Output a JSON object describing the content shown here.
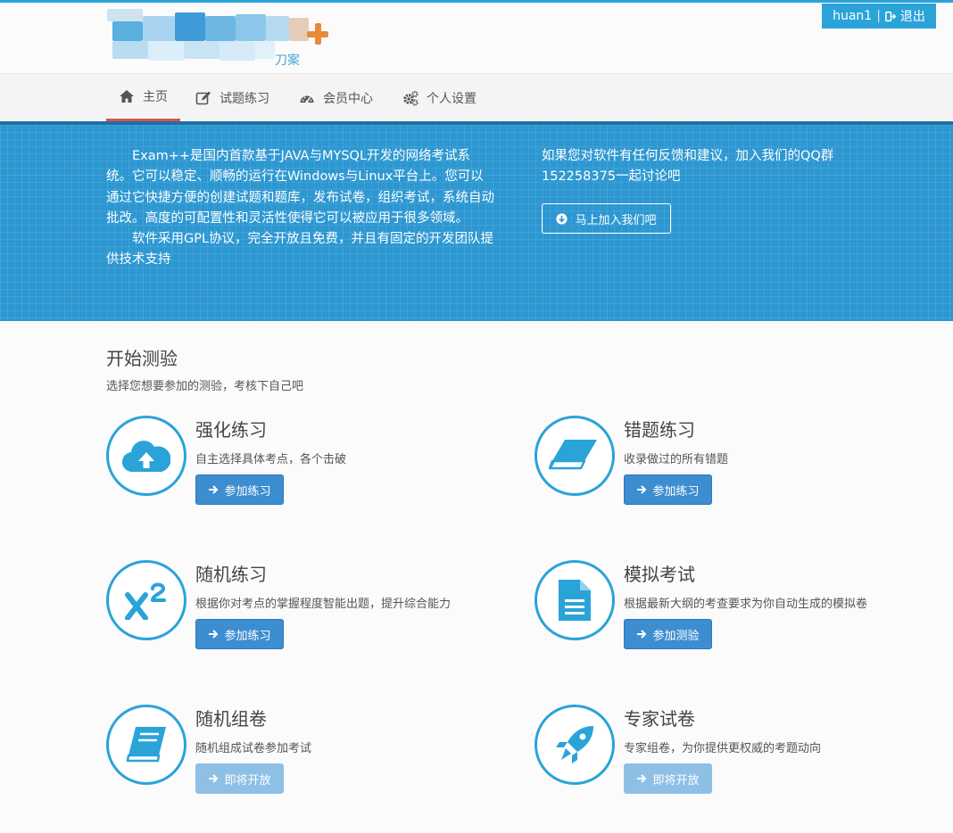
{
  "header": {
    "username": "huan1",
    "separator": "|",
    "logout_label": "退出",
    "logo_fragment": "刀案"
  },
  "nav": {
    "items": [
      {
        "label": "主页",
        "icon": "home-icon"
      },
      {
        "label": "试题练习",
        "icon": "edit-icon"
      },
      {
        "label": "会员中心",
        "icon": "dashboard-icon"
      },
      {
        "label": "个人设置",
        "icon": "cogs-icon"
      }
    ]
  },
  "banner": {
    "intro_p1": "Exam++是国内首款基于JAVA与MYSQL开发的网络考试系统。它可以稳定、顺畅的运行在Windows与Linux平台上。您可以通过它快捷方便的创建试题和题库，发布试卷，组织考试，系统自动批改。高度的可配置性和灵活性使得它可以被应用于很多领域。",
    "intro_p2": "软件采用GPL协议，完全开放且免费，并且有固定的开发团队提供技术支持",
    "feedback": "如果您对软件有任何反馈和建议，加入我们的QQ群152258375一起讨论吧",
    "join_button": "马上加入我们吧"
  },
  "section": {
    "title": "开始测验",
    "subtitle": "选择您想要参加的测验，考核下自己吧"
  },
  "cards": [
    {
      "title": "强化练习",
      "desc": "自主选择具体考点，各个击破",
      "button": "参加练习",
      "icon": "cloud-upload-icon",
      "disabled": false
    },
    {
      "title": "错题练习",
      "desc": "收录做过的所有错题",
      "button": "参加练习",
      "icon": "eraser-icon",
      "disabled": false
    },
    {
      "title": "随机练习",
      "desc": "根据你对考点的掌握程度智能出题，提升综合能力",
      "button": "参加练习",
      "icon": "superscript-icon",
      "disabled": false
    },
    {
      "title": "模拟考试",
      "desc": "根据最新大纲的考查要求为你自动生成的模拟卷",
      "button": "参加测验",
      "icon": "file-text-icon",
      "disabled": false
    },
    {
      "title": "随机组卷",
      "desc": "随机组成试卷参加考试",
      "button": "即将开放",
      "icon": "book-icon",
      "disabled": true
    },
    {
      "title": "专家试卷",
      "desc": "专家组卷，为你提供更权威的考题动向",
      "button": "即将开放",
      "icon": "rocket-icon",
      "disabled": true
    }
  ],
  "colors": {
    "accent": "#2aa3d9",
    "banner_bg": "#2c97d1",
    "button": "#3d8ed1",
    "button_disabled": "#8ec0e5",
    "active_underline": "#d9534f",
    "logo_plus": "#e8893b"
  }
}
